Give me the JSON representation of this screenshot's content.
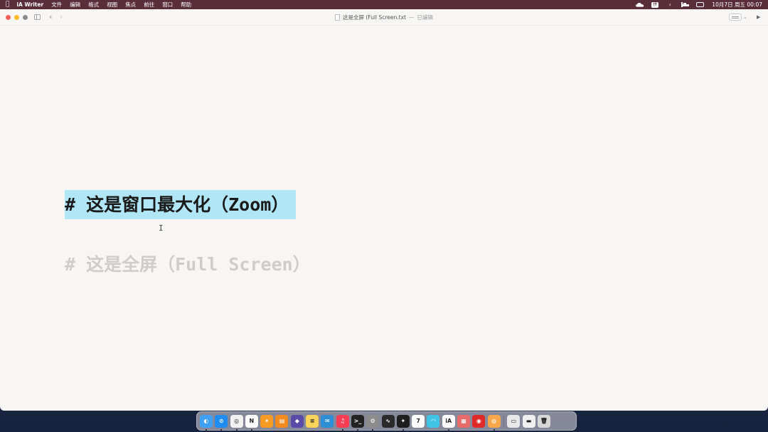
{
  "menubar": {
    "apple_icon": "",
    "app_name": "iA Writer",
    "items": [
      "文件",
      "编辑",
      "格式",
      "视图",
      "焦点",
      "前往",
      "窗口",
      "帮助"
    ],
    "status_icons": [
      "cloud-icon",
      "input-source-icon",
      "arrow-icon",
      "bed-icon",
      "battery-icon"
    ],
    "input_source": "拼",
    "clock": "10月7日 周五  00:07"
  },
  "window": {
    "title": "这是全屏 (Full Screen.txt",
    "title_separator": "—",
    "edited_status": "已编辑",
    "traffic_lights": [
      "close",
      "minimize",
      "maximize"
    ]
  },
  "editor": {
    "active_heading": "# 这是窗口最大化（Zoom）",
    "faded_heading": "# 这是全屏（Full Screen）",
    "highlight_color": "#b1e6f7"
  },
  "dock": {
    "apps": [
      {
        "name": "Finder",
        "icon": "finder-icon",
        "color": "#3fa1f5",
        "glyph": "◐",
        "running": true
      },
      {
        "name": "Safari",
        "icon": "safari-icon",
        "color": "#1e8cf0",
        "glyph": "⊙",
        "running": true
      },
      {
        "name": "Chrome",
        "icon": "chrome-icon",
        "color": "#f2f2f2",
        "glyph": "◎",
        "running": true
      },
      {
        "name": "Notion",
        "icon": "notion-icon",
        "color": "#ffffff",
        "glyph": "N",
        "running": true
      },
      {
        "name": "Butterfly",
        "icon": "butterfly-icon",
        "color": "#f59b23",
        "glyph": "✶",
        "running": false
      },
      {
        "name": "Books",
        "icon": "books-icon",
        "color": "#f28a1e",
        "glyph": "▤",
        "running": false
      },
      {
        "name": "Obsidian",
        "icon": "obsidian-icon",
        "color": "#5c4aa8",
        "glyph": "◆",
        "running": false
      },
      {
        "name": "Notes",
        "icon": "notes-icon",
        "color": "#fcd35a",
        "glyph": "≡",
        "running": false
      },
      {
        "name": "Airmail",
        "icon": "mail-icon",
        "color": "#2c8fd6",
        "glyph": "✉",
        "running": false
      },
      {
        "name": "Music",
        "icon": "music-icon",
        "color": "#fa3d55",
        "glyph": "♫",
        "running": true
      },
      {
        "name": "Terminal",
        "icon": "terminal-icon",
        "color": "#222222",
        "glyph": ">_",
        "running": true
      },
      {
        "name": "System Settings",
        "icon": "settings-icon",
        "color": "#8c8c8c",
        "glyph": "⚙",
        "running": true
      },
      {
        "name": "Activity Monitor",
        "icon": "monitor-icon",
        "color": "#2b2b2b",
        "glyph": "∿",
        "running": false
      },
      {
        "name": "Figma",
        "icon": "figma-icon",
        "color": "#1e1e1e",
        "glyph": "✦",
        "running": true
      },
      {
        "name": "Calendar",
        "icon": "calendar-icon",
        "color": "#ffffff",
        "glyph": "7",
        "running": false
      },
      {
        "name": "Tot",
        "icon": "tot-icon",
        "color": "#3fc4e6",
        "glyph": "◠",
        "running": false
      },
      {
        "name": "iA Writer",
        "icon": "ia-writer-icon",
        "color": "#ffffff",
        "glyph": "iA",
        "running": true
      },
      {
        "name": "Launcher",
        "icon": "grid-icon",
        "color": "#e86b6b",
        "glyph": "▦",
        "running": false
      },
      {
        "name": "NetEase Music",
        "icon": "netease-icon",
        "color": "#e02a2a",
        "glyph": "◉",
        "running": false
      },
      {
        "name": "Orange App",
        "icon": "orange-app-icon",
        "color": "#f7a74a",
        "glyph": "◍",
        "running": true
      }
    ],
    "extras": [
      {
        "name": "Downloads",
        "icon": "printer-icon",
        "color": "#e8e8e8",
        "glyph": "▭"
      },
      {
        "name": "Documents",
        "icon": "folder-icon",
        "color": "#f0f0f0",
        "glyph": "▬"
      },
      {
        "name": "Trash",
        "icon": "trash-icon",
        "color": "#d8d8d8",
        "glyph": "🗑"
      }
    ]
  }
}
